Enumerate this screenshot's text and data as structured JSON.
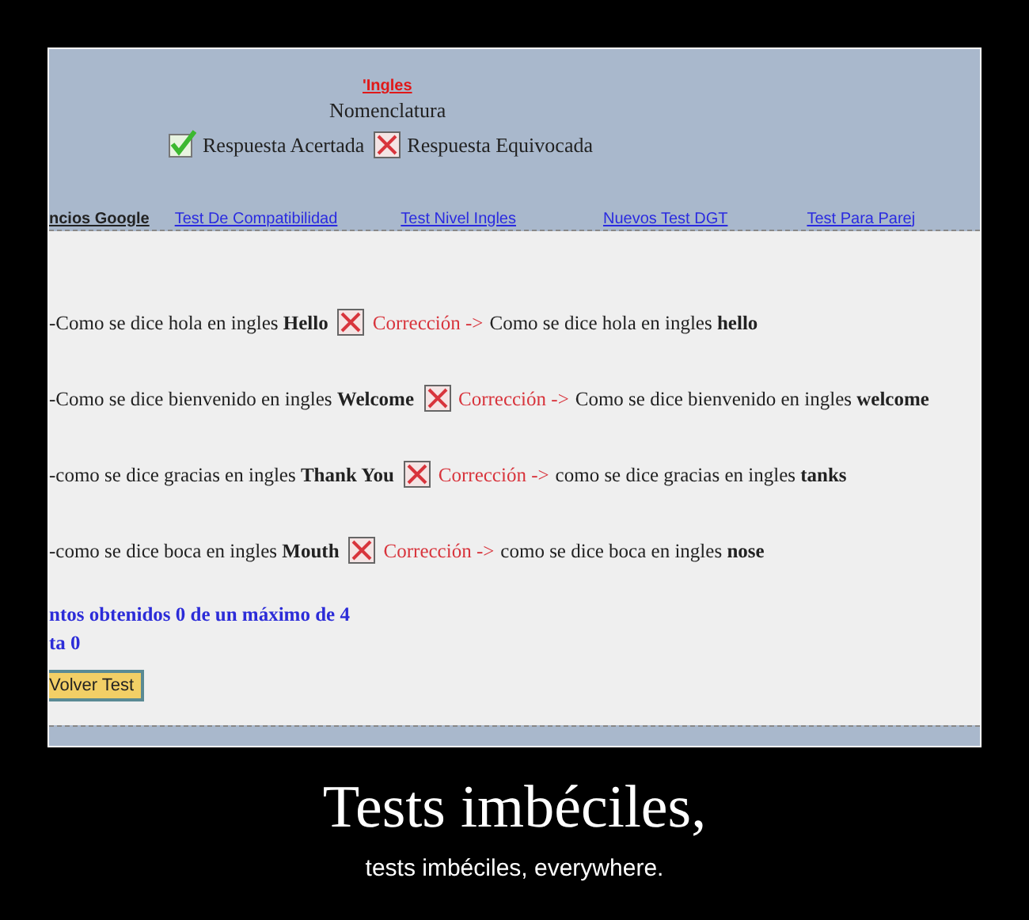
{
  "header": {
    "title": "'Ingles",
    "subtitle": "Nomenclatura",
    "legend": [
      {
        "kind": "correct",
        "label": "Respuesta Acertada"
      },
      {
        "kind": "wrong",
        "label": "Respuesta Equivocada"
      }
    ]
  },
  "nav": [
    {
      "label": "ncios Google",
      "kind": "bold"
    },
    {
      "label": "Test De Compatibilidad",
      "kind": "link"
    },
    {
      "label": "Test Nivel Ingles",
      "kind": "link"
    },
    {
      "label": "Nuevos Test DGT",
      "kind": "link"
    },
    {
      "label": "Test Para Parej",
      "kind": "link"
    }
  ],
  "questions": [
    {
      "prompt": "-Como se dice hola en ingles **Hello**",
      "correct": false,
      "correction_label": "Corrección ->",
      "correction": "Como se dice hola en ingles **hello**"
    },
    {
      "prompt": "-Como se dice bienvenido en ingles **Welcome**",
      "correct": false,
      "correction_label": "Corrección ->",
      "correction": "Como se dice bienvenido en ingles **welcome**"
    },
    {
      "prompt": "-como se dice gracias en ingles **Thank You**",
      "correct": false,
      "correction_label": "Corrección ->",
      "correction": "como se dice gracias en ingles **tanks**"
    },
    {
      "prompt": "-como se dice boca en ingles **Mouth**",
      "correct": false,
      "correction_label": "Corrección ->",
      "correction": "como se dice boca en ingles **nose**"
    }
  ],
  "score": [
    "ntos obtenidos 0 de un máximo de 4",
    "ta 0"
  ],
  "button": "Volver Test",
  "caption": {
    "title": "Tests imbéciles,",
    "subtitle": "tests imbéciles, everywhere."
  }
}
